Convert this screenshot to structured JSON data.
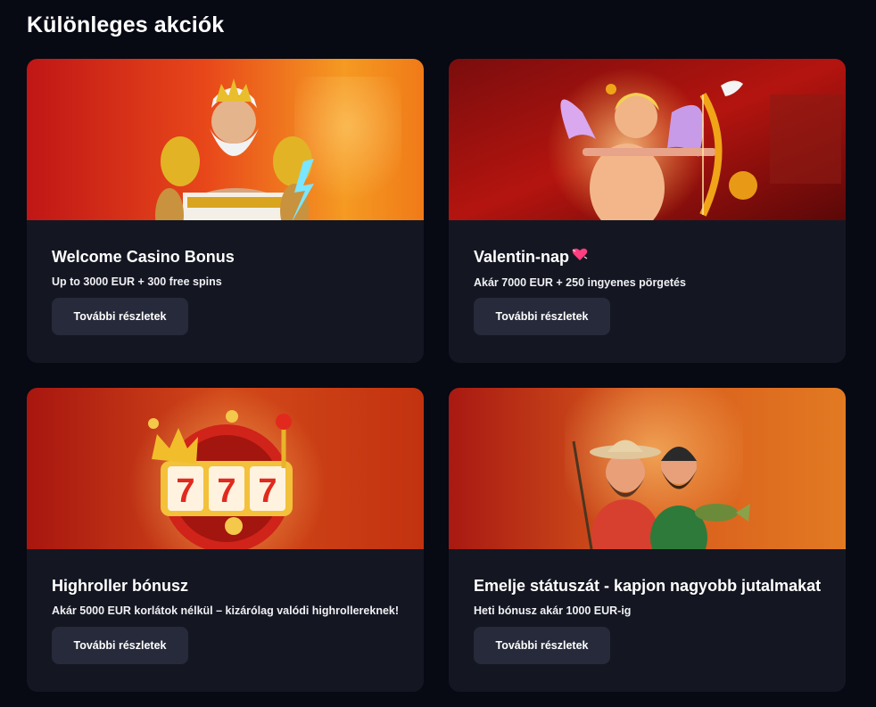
{
  "page": {
    "title": "Különleges akciók"
  },
  "colors": {
    "background": "#070913",
    "card": "#141722",
    "button": "#262a3a",
    "heart": "#ff3d7f"
  },
  "promotions": [
    {
      "title": "Welcome Casino Bonus",
      "subtitle": "Up to 3000 EUR + 300 free spins",
      "button": "További részletek",
      "image": "zeus-illustration"
    },
    {
      "title": "Valentin-nap",
      "title_icon": "heart-icon",
      "subtitle": "Akár 7000 EUR + 250 ingyenes pörgetés",
      "button": "További részletek",
      "image": "cupid-illustration"
    },
    {
      "title": "Highroller bónusz",
      "subtitle": "Akár 5000 EUR korlátok nélkül – kizárólag valódi highrollereknek!",
      "button": "További részletek",
      "image": "slot-machine-777-illustration"
    },
    {
      "title": "Emelje státuszát - kapjon nagyobb jutalmakat",
      "subtitle": "Heti bónusz akár 1000 EUR-ig",
      "button": "További részletek",
      "image": "fishermen-illustration"
    }
  ]
}
